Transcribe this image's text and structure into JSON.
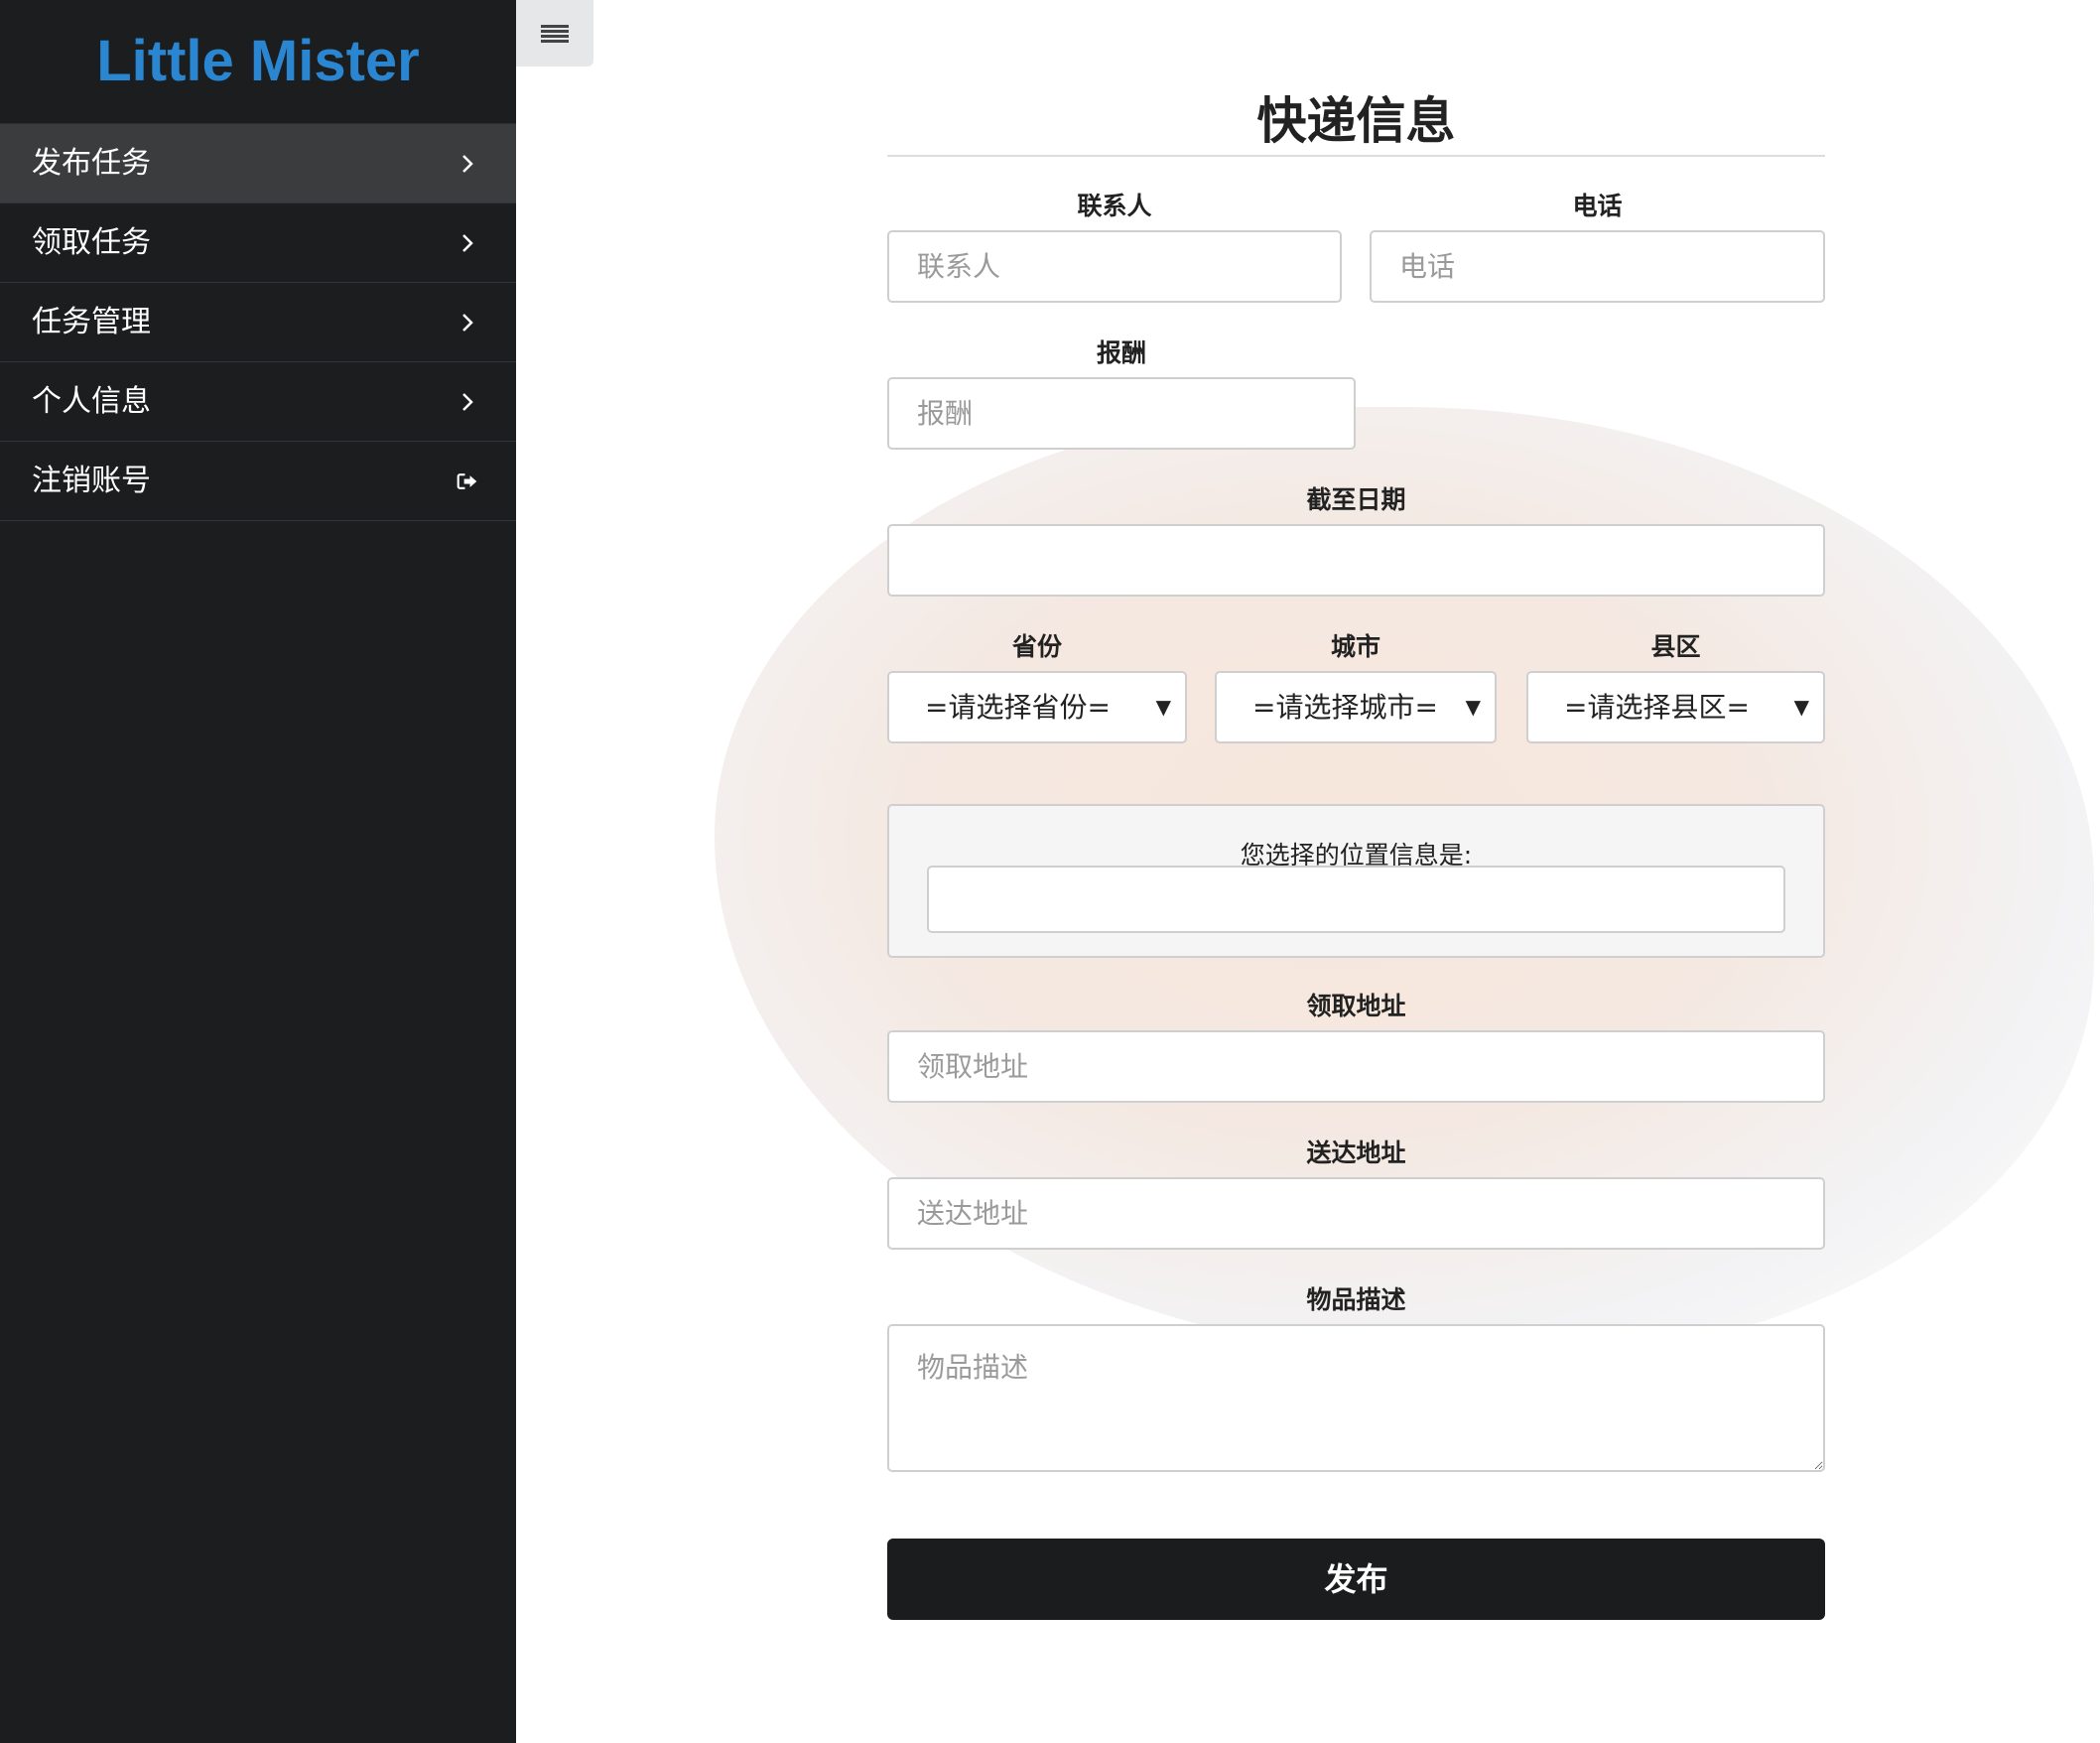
{
  "sidebar": {
    "brand": "Little Mister",
    "items": [
      {
        "label": "发布任务",
        "icon": "chevron-right-icon",
        "active": true
      },
      {
        "label": "领取任务",
        "icon": "chevron-right-icon",
        "active": false
      },
      {
        "label": "任务管理",
        "icon": "chevron-right-icon",
        "active": false
      },
      {
        "label": "个人信息",
        "icon": "chevron-right-icon",
        "active": false
      },
      {
        "label": "注销账号",
        "icon": "sign-out-icon",
        "active": false
      }
    ]
  },
  "toolbar": {
    "menu_icon": "hamburger-menu-icon"
  },
  "form": {
    "title": "快递信息",
    "contact": {
      "label": "联系人",
      "placeholder": "联系人"
    },
    "phone": {
      "label": "电话",
      "placeholder": "电话"
    },
    "reward": {
      "label": "报酬",
      "placeholder": "报酬"
    },
    "deadline": {
      "label": "截至日期",
      "placeholder": ""
    },
    "province": {
      "label": "省份",
      "selected": "=请选择省份="
    },
    "city": {
      "label": "城市",
      "selected": "=请选择城市="
    },
    "district": {
      "label": "县区",
      "selected": "=请选择县区="
    },
    "location": {
      "label": "您选择的位置信息是:",
      "value": ""
    },
    "pickup": {
      "label": "领取地址",
      "placeholder": "领取地址"
    },
    "delivery": {
      "label": "送达地址",
      "placeholder": "送达地址"
    },
    "description": {
      "label": "物品描述",
      "placeholder": "物品描述"
    },
    "submit_label": "发布"
  },
  "colors": {
    "sidebar_bg": "#1c1d1f",
    "brand": "#2a86d1",
    "active_item": "#3b3c3e",
    "submit_bg": "#1b1c1e"
  }
}
